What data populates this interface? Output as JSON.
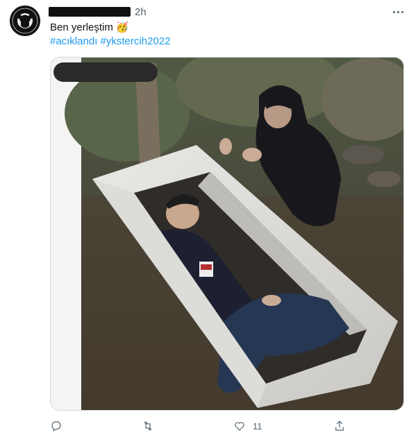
{
  "tweet": {
    "timestamp": "2h",
    "text": "Ben yerleştim",
    "hashtags": "#acıklandı #ykstercih2022",
    "emoji": "🥳"
  },
  "actions": {
    "reply_icon": "reply-icon",
    "retweet_icon": "retweet-icon",
    "like_icon": "heart-icon",
    "like_count": "11",
    "share_icon": "share-icon"
  },
  "colors": {
    "link": "#1d9bf0",
    "muted": "#536471",
    "border": "#cfd9de"
  }
}
